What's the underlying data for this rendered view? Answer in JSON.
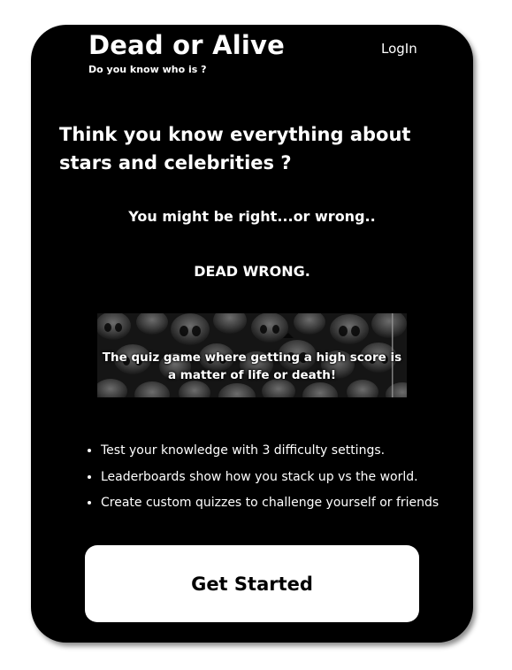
{
  "header": {
    "title": "Dead or Alive",
    "tagline": "Do you know who is ?",
    "login_label": "LogIn"
  },
  "hero": {
    "headline": "Think you know everything about stars and celebrities ?",
    "subline_1": "You might be right...or wrong..",
    "subline_2": "DEAD WRONG."
  },
  "banner": {
    "image": "skulls-background",
    "text": "The quiz game where getting a high score is a matter of life or death!"
  },
  "features": [
    "Test your knowledge with 3 difficulty settings.",
    "Leaderboards show how you stack up vs the world.",
    "Create custom quizzes to challenge yourself or friends"
  ],
  "cta": {
    "label": "Get Started"
  },
  "colors": {
    "card_background": "#000000",
    "text": "#ffffff",
    "button_background": "#ffffff",
    "button_text": "#000000"
  }
}
